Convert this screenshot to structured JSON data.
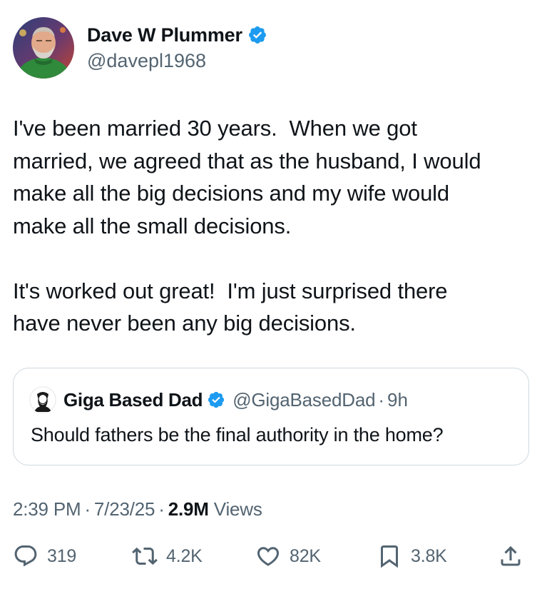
{
  "author": {
    "name": "Dave W Plummer",
    "handle": "@davepl1968"
  },
  "tweet": {
    "text": "I've been married 30 years.  When we got\nmarried, we agreed that as the husband, I would\nmake all the big decisions and my wife would\nmake all the small decisions.\n\nIt's worked out great!  I'm just surprised there\nhave never been any big decisions."
  },
  "quote": {
    "name": "Giga Based Dad",
    "handle": "@GigaBasedDad",
    "dot": "·",
    "time": "9h",
    "text": "Should fathers be the final authority in the home?"
  },
  "meta": {
    "time": "2:39 PM",
    "sep": "·",
    "date": "7/23/25",
    "views_count": "2.9M",
    "views_label": "Views"
  },
  "actions": {
    "replies": "319",
    "reposts": "4.2K",
    "likes": "82K",
    "bookmarks": "3.8K"
  },
  "colors": {
    "verified": "#1d9bf0",
    "secondary_text": "#536471",
    "primary_text": "#0f1419",
    "border": "#cfd9de"
  },
  "icons": [
    "verified-badge-icon",
    "reply-icon",
    "repost-icon",
    "like-icon",
    "bookmark-icon",
    "share-icon"
  ]
}
